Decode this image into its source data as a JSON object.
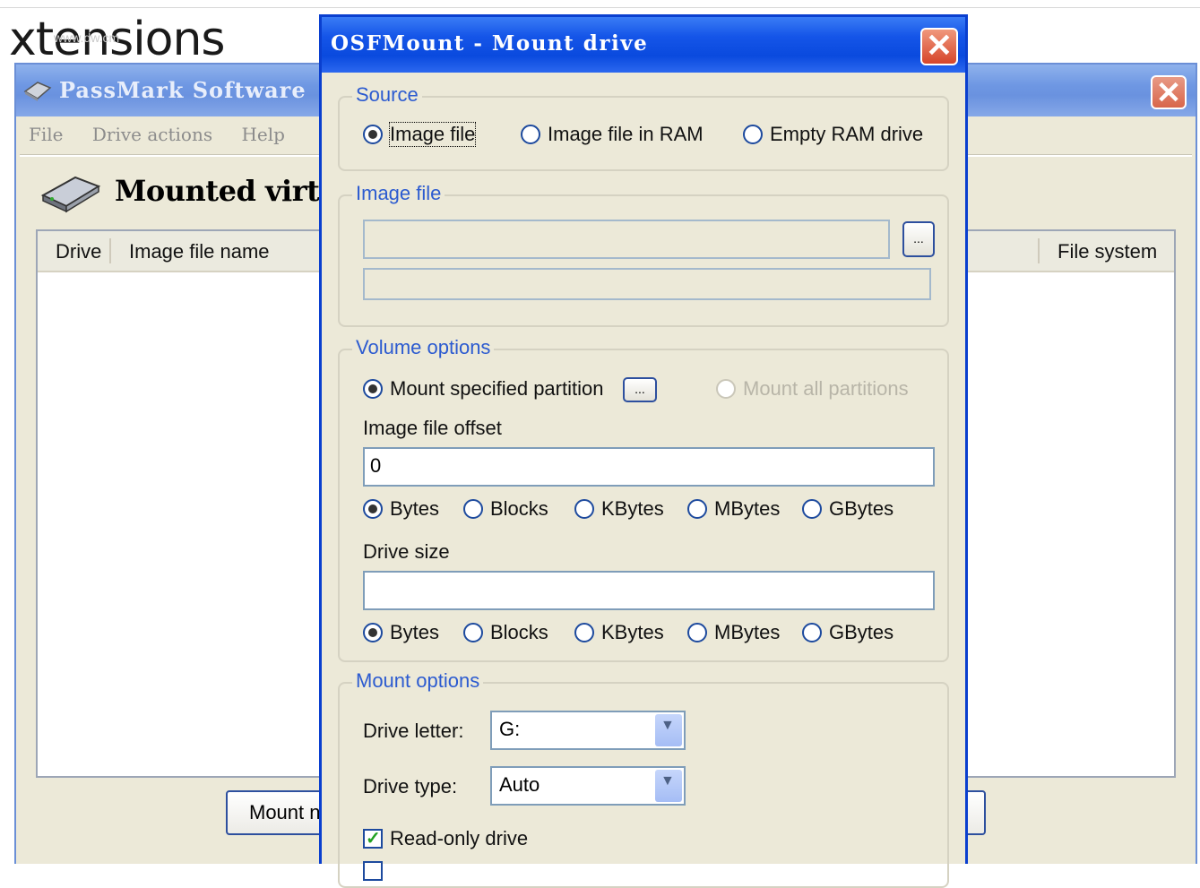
{
  "background": {
    "heading": "xtensions",
    "watermark": "www.dw.cm",
    "main_window": {
      "title": "PassMark Software",
      "menu": [
        "File",
        "Drive actions",
        "Help"
      ],
      "mounted_label": "Mounted virtual",
      "columns": [
        "Drive",
        "Image file name",
        "File system"
      ],
      "mount_button": "Mount n"
    }
  },
  "dialog": {
    "title": "OSFMount - Mount drive",
    "close_symbol": "✕",
    "source": {
      "title": "Source",
      "options": [
        "Image file",
        "Image file in RAM",
        "Empty RAM drive"
      ],
      "selected": 0
    },
    "image_file": {
      "title": "Image file",
      "path_value": "",
      "browse_label": "...",
      "info_value": ""
    },
    "volume_options": {
      "title": "Volume options",
      "mount_specified": "Mount specified partition",
      "partition_browse": "...",
      "mount_all": "Mount all partitions",
      "offset_label": "Image file offset",
      "offset_value": "0",
      "units": [
        "Bytes",
        "Blocks",
        "KBytes",
        "MBytes",
        "GBytes"
      ],
      "size_label": "Drive size",
      "size_value": ""
    },
    "mount_options": {
      "title": "Mount options",
      "drive_letter_label": "Drive letter:",
      "drive_letter_value": "G:",
      "drive_type_label": "Drive type:",
      "drive_type_value": "Auto",
      "readonly_label": "Read-only drive",
      "readonly_checked": true
    }
  },
  "icons": {
    "dropdown": "chevron-down-icon",
    "check": "checkmark-icon"
  },
  "colors": {
    "dialog_title": "#0a4ade",
    "group_title": "#2c5bd0",
    "panel": "#ece9d8"
  }
}
